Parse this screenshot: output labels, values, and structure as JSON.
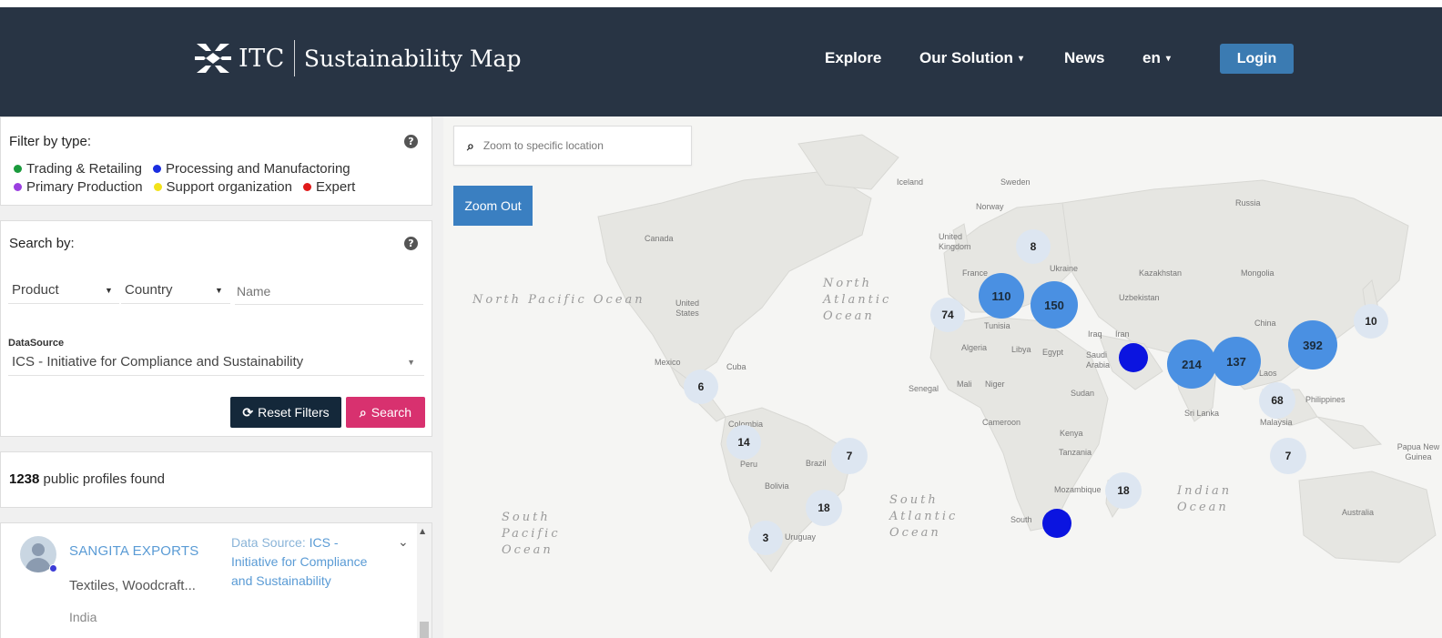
{
  "header": {
    "logo_text": "ITC",
    "logo_subtitle": "Sustainability Map",
    "nav": {
      "explore": "Explore",
      "our_solution": "Our Solution",
      "news": "News",
      "language": "en",
      "login": "Login"
    }
  },
  "filter": {
    "title": "Filter by type:",
    "types": [
      {
        "label": "Trading & Retailing",
        "color": "#1a9a3c"
      },
      {
        "label": "Processing and Manufactoring",
        "color": "#1a2de0"
      },
      {
        "label": "Primary Production",
        "color": "#9b3fe0"
      },
      {
        "label": "Support organization",
        "color": "#f2e21a"
      },
      {
        "label": "Expert",
        "color": "#e01a1a"
      }
    ]
  },
  "search": {
    "title": "Search by:",
    "product_label": "Product",
    "country_label": "Country",
    "name_placeholder": "Name",
    "datasource_label": "DataSource",
    "datasource_value": "ICS - Initiative for Compliance and Sustainability",
    "reset_label": "Reset Filters",
    "search_label": "Search"
  },
  "results": {
    "count": "1238",
    "suffix": "public profiles found"
  },
  "profiles": [
    {
      "name": "SANGITA EXPORTS",
      "products": "Textiles, Woodcraft...",
      "country": "India",
      "data_source_prefix": "Data Source:",
      "data_source": "ICS - Initiative for Compliance and Sustainability"
    }
  ],
  "map": {
    "search_placeholder": "Zoom to specific location",
    "zoom_out_label": "Zoom Out",
    "oceans": {
      "north_pacific": "North Pacific Ocean",
      "north_atlantic": "North Atlantic Ocean",
      "south_pacific": "South Pacific Ocean",
      "south_atlantic": "South Atlantic Ocean",
      "indian": "Indian Ocean"
    },
    "places": [
      "Iceland",
      "Sweden",
      "Norway",
      "Russia",
      "Canada",
      "United Kingdom",
      "France",
      "Ukraine",
      "Kazakhstan",
      "Mongolia",
      "Uzbekistan",
      "United States",
      "Tunisia",
      "Iraq",
      "Iran",
      "China",
      "Algeria",
      "Libya",
      "Egypt",
      "Saudi Arabia",
      "Mexico",
      "Cuba",
      "Senegal",
      "Mali",
      "Niger",
      "Sudan",
      "Laos",
      "Philippines",
      "Sri Lanka",
      "Malaysia",
      "Colombia",
      "Cameroon",
      "Kenya",
      "Peru",
      "Brazil",
      "Tanzania",
      "Papua New Guinea",
      "Bolivia",
      "Mozambique",
      "Uruguay",
      "South",
      "Australia"
    ],
    "clusters": [
      "8",
      "110",
      "150",
      "74",
      "10",
      "392",
      "214",
      "137",
      "6",
      "68",
      "14",
      "7",
      "7",
      "18",
      "18",
      "3"
    ]
  }
}
